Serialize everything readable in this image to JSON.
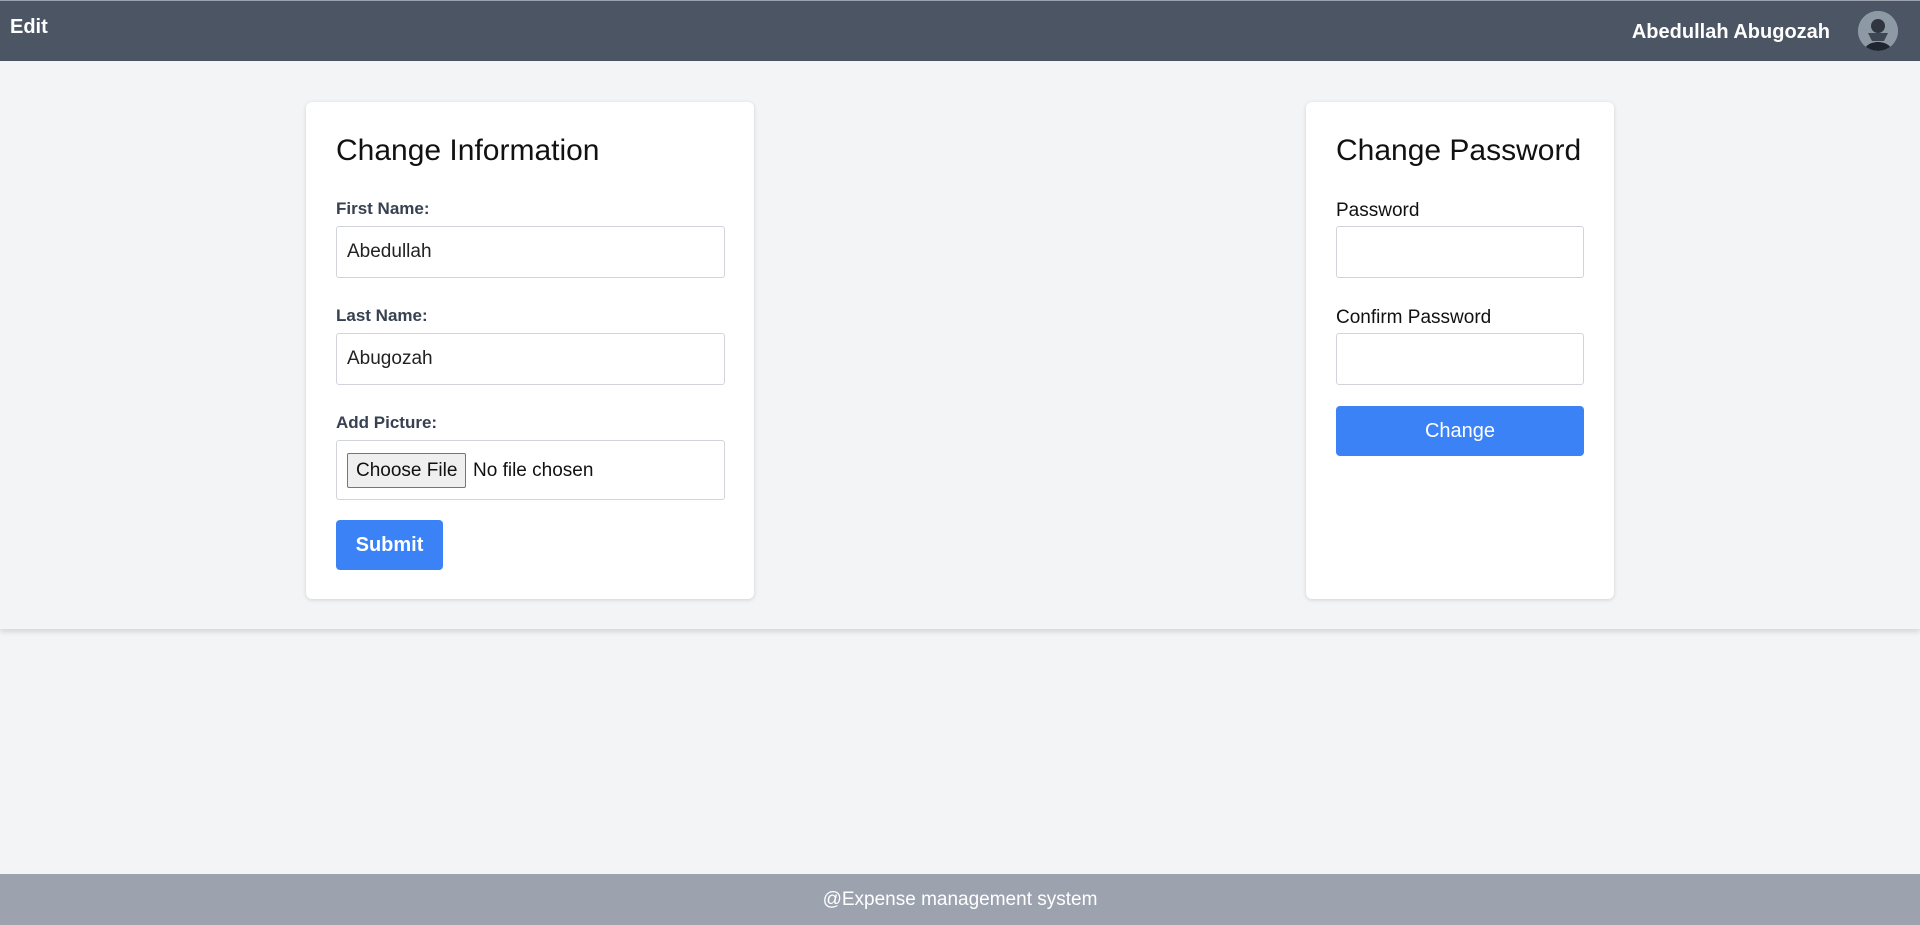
{
  "header": {
    "title": "Edit",
    "user_name": "Abedullah Abugozah",
    "avatar_icon": "user-avatar"
  },
  "info_card": {
    "heading": "Change Information",
    "first_name_label": "First Name:",
    "first_name_value": "Abedullah",
    "last_name_label": "Last Name:",
    "last_name_value": "Abugozah",
    "picture_label": "Add Picture:",
    "choose_file_label": "Choose File",
    "file_status": "No file chosen",
    "submit_label": "Submit"
  },
  "password_card": {
    "heading": "Change Password",
    "password_label": "Password",
    "password_value": "",
    "confirm_label": "Confirm Password",
    "confirm_value": "",
    "change_label": "Change"
  },
  "footer": {
    "text": "@Expense management system"
  },
  "colors": {
    "header_bg": "#4b5563",
    "page_bg": "#f3f4f6",
    "accent": "#3b82f6",
    "footer_bg": "#9ca3af"
  }
}
